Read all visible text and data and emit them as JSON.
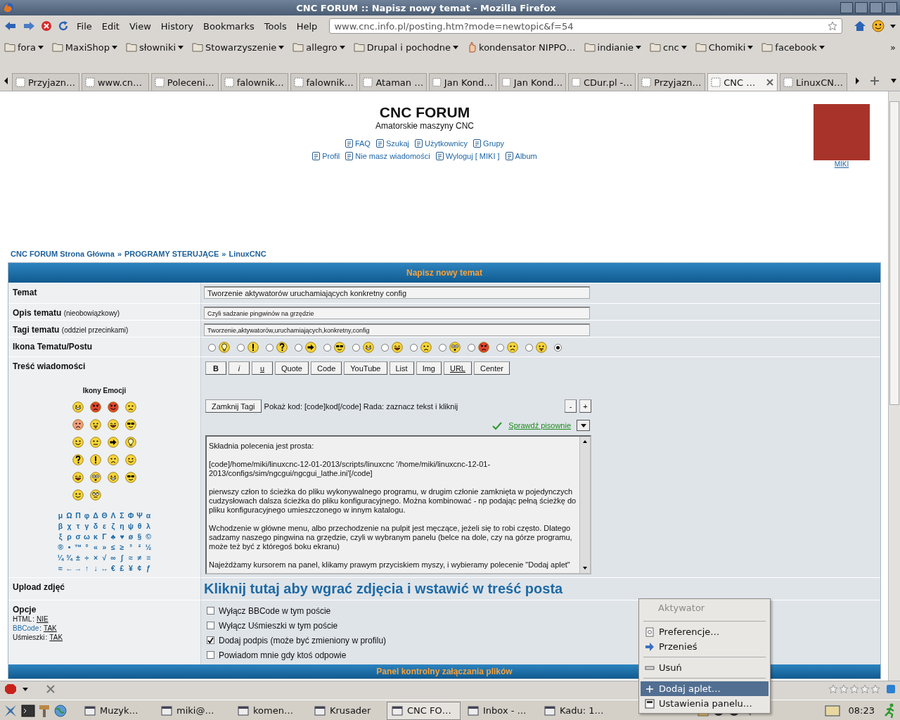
{
  "window": {
    "title": "CNC FORUM :: Napisz nowy temat - Mozilla Firefox"
  },
  "menu": [
    "File",
    "Edit",
    "View",
    "History",
    "Bookmarks",
    "Tools",
    "Help"
  ],
  "address": {
    "value": "www.cnc.info.pl/posting.htm?mode=newtopic&f=54"
  },
  "bookmarks": [
    {
      "label": "fora",
      "kind": "folder"
    },
    {
      "label": "MaxiShop",
      "kind": "folder"
    },
    {
      "label": "słowniki",
      "kind": "folder"
    },
    {
      "label": "Stowarzyszenie",
      "kind": "folder"
    },
    {
      "label": "allegro",
      "kind": "folder"
    },
    {
      "label": "Drupal i pochodne",
      "kind": "folder"
    },
    {
      "label": "kondensator NIPPO…",
      "kind": "page"
    },
    {
      "label": "indianie",
      "kind": "folder"
    },
    {
      "label": "cnc",
      "kind": "folder"
    },
    {
      "label": "Chomiki",
      "kind": "folder"
    },
    {
      "label": "facebook",
      "kind": "folder"
    }
  ],
  "bookmarks_overflow": "»",
  "tabs": [
    {
      "label": "Przyjazn…",
      "selected": false
    },
    {
      "label": "www.cn…",
      "selected": false
    },
    {
      "label": "Poleceni…",
      "selected": false
    },
    {
      "label": "falownik…",
      "selected": false
    },
    {
      "label": "falownik…",
      "selected": false
    },
    {
      "label": "Ataman …",
      "selected": false
    },
    {
      "label": "Jan Kond…",
      "selected": false
    },
    {
      "label": "Jan Kond…",
      "selected": false
    },
    {
      "label": "CDur.pl -…",
      "selected": false
    },
    {
      "label": "Przyjazn…",
      "selected": false
    },
    {
      "label": "CNC …",
      "selected": true
    },
    {
      "label": "LinuxCN…",
      "selected": false
    }
  ],
  "header": {
    "title": "CNC FORUM",
    "subtitle": "Amatorskie maszyny CNC",
    "links_row_1": [
      "FAQ",
      "Szukaj",
      "Użytkownicy",
      "Grupy"
    ],
    "links_row_2": [
      "Profil",
      "Nie masz wiadomości",
      "Wyloguj [ MIKI ]",
      "Album"
    ],
    "user": "MIKI"
  },
  "breadcrumb": [
    {
      "label": "CNC FORUM Strona Główna"
    },
    {
      "sep": "»",
      "label": "PROGRAMY STERUJĄCE"
    },
    {
      "sep": "»",
      "label": "LinuxCNC"
    }
  ],
  "form": {
    "title": "Napisz nowy temat",
    "subject": {
      "label": "Temat",
      "value": "Tworzenie aktywatorów uruchamiających konkretny config"
    },
    "description": {
      "label": "Opis tematu",
      "note": "(nieobowiązkowy)",
      "value": "Czyli sadzanie pingwinów na grzędzie"
    },
    "tags": {
      "label": "Tagi tematu",
      "note": "(oddziel przecinkami)",
      "value": "Tworzenie,aktywatorów,uruchamiających,konkretny,config"
    },
    "post_icon": {
      "label": "Ikona Tematu/Postu",
      "options": [
        {
          "kind": "idea",
          "selected": false
        },
        {
          "kind": "exclaim",
          "selected": false
        },
        {
          "kind": "question",
          "selected": false
        },
        {
          "kind": "arrow",
          "selected": false
        },
        {
          "kind": "cool",
          "selected": false
        },
        {
          "kind": "grin",
          "selected": false
        },
        {
          "kind": "lol",
          "selected": false
        },
        {
          "kind": "sad",
          "selected": false
        },
        {
          "kind": "eek",
          "selected": false
        },
        {
          "kind": "mad",
          "selected": false
        },
        {
          "kind": "sad",
          "selected": false
        },
        {
          "kind": "razz",
          "selected": false
        },
        {
          "kind": "none",
          "selected": true
        }
      ]
    },
    "message": {
      "label": "Treść wiadomości",
      "emoticons_title": "Ikony Emocji",
      "emoticons": [
        {
          "kind": "grin"
        },
        {
          "kind": "mad"
        },
        {
          "kind": "evil"
        },
        {
          "kind": "sad"
        },
        {
          "kind": "redface"
        },
        {
          "kind": "razz"
        },
        {
          "kind": "lol"
        },
        {
          "kind": "cool"
        },
        {
          "kind": "smile"
        },
        {
          "kind": "neutral"
        },
        {
          "kind": "arrow"
        },
        {
          "kind": "idea"
        },
        {
          "kind": "question"
        },
        {
          "kind": "exclaim"
        },
        {
          "kind": "sad"
        },
        {
          "kind": "smile"
        },
        {
          "kind": "lol"
        },
        {
          "kind": "eek"
        },
        {
          "kind": "grin"
        },
        {
          "kind": "cool"
        },
        {
          "kind": "smile"
        },
        {
          "kind": "rolleyes"
        }
      ],
      "special_chars": [
        "μ",
        "Ω",
        "Π",
        "φ",
        "Δ",
        "Θ",
        "Λ",
        "Σ",
        "Φ",
        "Ψ",
        "α",
        "β",
        "χ",
        "τ",
        "γ",
        "δ",
        "ε",
        "ζ",
        "η",
        "ψ",
        "θ",
        "λ",
        "ξ",
        "ρ",
        "σ",
        "ω",
        "κ",
        "Γ",
        "♣",
        "♥",
        "ø",
        "§",
        "©",
        "®",
        "•",
        "™",
        "°",
        "«",
        "»",
        "≤",
        "≥",
        "³",
        "²",
        "½",
        "¼",
        "¾",
        "±",
        "÷",
        "×",
        "√",
        "∞",
        "∫",
        "≈",
        "≠",
        "≡",
        "≈",
        "←",
        "→",
        "↑",
        "↓",
        "↔",
        "€",
        "£",
        "¥",
        "¢",
        "ƒ"
      ],
      "toolbar": [
        {
          "label": "B",
          "kind": "bold"
        },
        {
          "label": "i",
          "kind": "italic"
        },
        {
          "label": "u",
          "kind": "underline"
        },
        {
          "label": "Quote",
          "kind": "plain"
        },
        {
          "label": "Code",
          "kind": "plain"
        },
        {
          "label": "YouTube",
          "kind": "plain"
        },
        {
          "label": "List",
          "kind": "plain"
        },
        {
          "label": "Img",
          "kind": "plain"
        },
        {
          "label": "URL",
          "kind": "underline"
        },
        {
          "label": "Center",
          "kind": "plain"
        }
      ],
      "close_tags": "Zamknij Tagi",
      "hint": "Pokaż kod: [code]kod[/code] Rada: zaznacz tekst i kliknij",
      "size_buttons": [
        "-",
        "+"
      ],
      "spellcheck": "Sprawdź pisownie",
      "text": "Składnia polecenia jest prosta:\n\n[code]/home/miki/linuxcnc-12-01-2013/scripts/linuxcnc '/home/miki/linuxcnc-12-01-2013/configs/sim/ngcgui/ngcgui_lathe.ini'[/code]\n\npierwszy człon to ścieżka do pliku wykonywalnego programu, w drugim członie zamknięta w pojedynczych cudzysłowach dalsza ścieżka do pliku konfiguracyjnego. Można kombinować - np podając pełną ścieżkę do pliku konfiguracyjnego umieszczonego w innym katalogu.\n\nWchodzenie w główne menu, albo przechodzenie na pulpit jest męczące, jeżeli się to robi często. Dlatego sadzamy naszego pingwina na grzędzie, czyli w wybranym panelu (belce na dole, czy na górze programu, może też być z któregoś boku ekranu)\n\nNajeżdżamy kursorem na panel, klikamy prawym przyciskiem myszy, i wybieramy polecenie \"Dodaj aplet\""
    },
    "upload": {
      "label": "Upload zdjęć",
      "link": "Kliknij tutaj aby wgrać zdjęcia i wstawić w treść posta"
    },
    "options": {
      "label": "Opcje",
      "settings": [
        {
          "name": "HTML",
          "after": ":",
          "value": "NIE",
          "link": false
        },
        {
          "name": "BBCode",
          "after": ":",
          "value": "TAK",
          "link": true
        },
        {
          "name": "Uśmieszki",
          "after": ":",
          "value": "TAK",
          "link": false
        }
      ],
      "checkboxes": [
        {
          "label": "Wyłącz BBCode w tym poście",
          "checked": false
        },
        {
          "label": "Wyłącz Uśmieszki w tym poście",
          "checked": false
        },
        {
          "label": "Dodaj podpis (może być zmieniony w profilu)",
          "checked": true
        },
        {
          "label": "Powiadom mnie gdy ktoś odpowie",
          "checked": false
        }
      ]
    },
    "attachments_title": "Panel kontrolny załączania plików"
  },
  "status_bar": {
    "stars": 0
  },
  "taskbar": {
    "tasks": [
      {
        "label": "Muzyk…",
        "selected": false
      },
      {
        "label": "miki@…",
        "selected": false
      },
      {
        "label": "komen…",
        "selected": false
      },
      {
        "label": "Krusader",
        "selected": false
      },
      {
        "label": "CNC FO…",
        "selected": true
      },
      {
        "label": "Inbox - …",
        "selected": false
      },
      {
        "label": "Kadu: 1…",
        "selected": false
      }
    ],
    "clock": "08:23"
  },
  "context_menu": {
    "items": [
      {
        "kind": "title",
        "label": "Aktywator"
      },
      {
        "kind": "separator"
      },
      {
        "kind": "prefs",
        "label": "Preferencje…",
        "selected": false
      },
      {
        "kind": "move",
        "label": "Przenieś",
        "selected": false
      },
      {
        "kind": "separator"
      },
      {
        "kind": "remove",
        "label": "Usuń",
        "selected": false
      },
      {
        "kind": "separator"
      },
      {
        "kind": "add",
        "label": "Dodaj aplet…",
        "selected": true
      },
      {
        "kind": "settings",
        "label": "Ustawienia panelu…",
        "selected": false
      }
    ]
  }
}
